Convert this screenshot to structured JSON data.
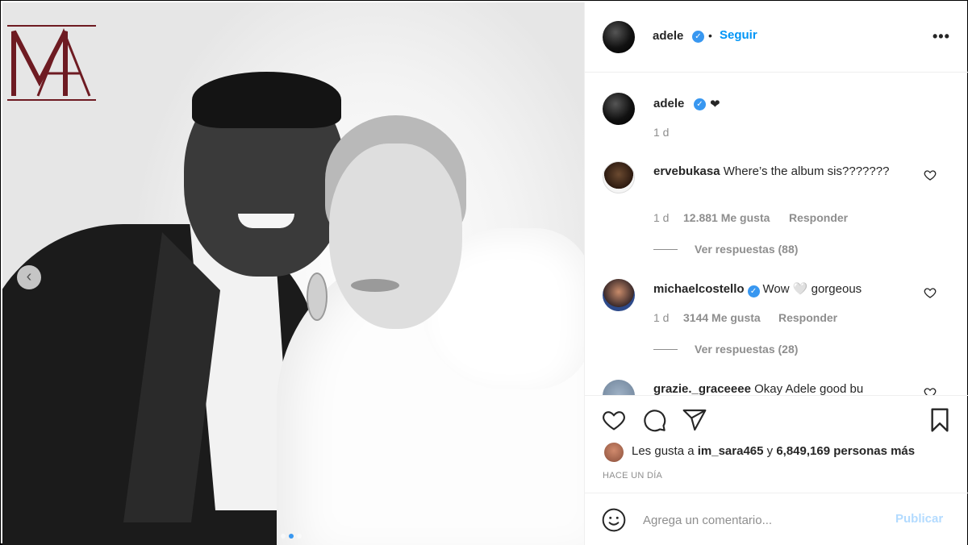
{
  "post": {
    "author": "adele",
    "follow_label": "Seguir",
    "more_icon": "more-horizontal-icon",
    "caption": "❤",
    "caption_time": "1 d",
    "brand_logo": "MA",
    "carousel_slides": 3,
    "carousel_active": 2
  },
  "comments": [
    {
      "username": "ervebukasa",
      "text": "Where’s the album sis???????",
      "time": "1 d",
      "likes": "12.881 Me gusta",
      "reply": "Responder",
      "view_replies": "Ver respuestas (88)"
    },
    {
      "username": "michaelcostello",
      "verified": true,
      "text": "Wow 🤍 gorgeous",
      "time": "1 d",
      "likes": "3144 Me gusta",
      "reply": "Responder",
      "view_replies": "Ver respuestas (28)"
    },
    {
      "username": "grazie._graceeee",
      "text": "Okay Adele good bu"
    }
  ],
  "actions": {
    "like_icon": "heart-icon",
    "comment_icon": "comment-icon",
    "share_icon": "paper-plane-icon",
    "save_icon": "bookmark-icon"
  },
  "likes": {
    "prefix": "Les gusta a",
    "user": "im_sara465",
    "connector": "y",
    "count": "6,849,169 personas más"
  },
  "time_ago": "HACE UN DÍA",
  "composer": {
    "placeholder": "Agrega un comentario...",
    "publish_label": "Publicar",
    "emoji_icon": "emoji-icon"
  },
  "colors": {
    "accent": "#0095f6",
    "verified": "#3897f0",
    "publish_disabled": "#b3dbff",
    "logo": "#6e1b22"
  }
}
